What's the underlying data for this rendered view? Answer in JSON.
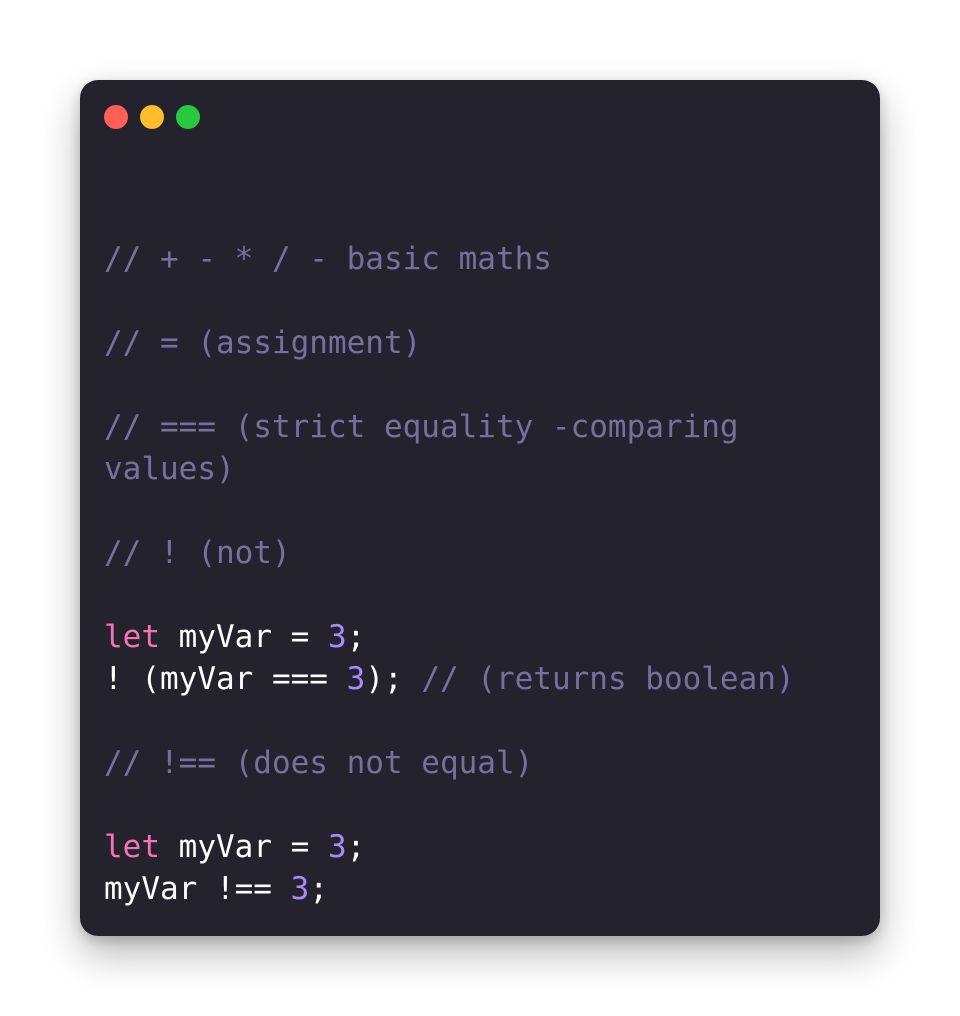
{
  "window": {
    "controls": [
      {
        "name": "close",
        "color": "#ff5f57"
      },
      {
        "name": "minimize",
        "color": "#febc2e"
      },
      {
        "name": "zoom",
        "color": "#28c840"
      }
    ]
  },
  "colors": {
    "background": "#24222c",
    "comment": "#77709f",
    "keyword": "#f472b6",
    "number": "#a78bfa",
    "text": "#ffffff"
  },
  "code": {
    "lines": [
      [
        {
          "type": "comment",
          "text": "// + - * / - basic maths"
        }
      ],
      [],
      [
        {
          "type": "comment",
          "text": "// = (assignment)"
        }
      ],
      [],
      [
        {
          "type": "comment",
          "text": "// === (strict equality -comparing"
        }
      ],
      [
        {
          "type": "comment",
          "text": "values)"
        }
      ],
      [],
      [
        {
          "type": "comment",
          "text": "// ! (not)"
        }
      ],
      [],
      [
        {
          "type": "keyword",
          "text": "let"
        },
        {
          "type": "plain",
          "text": " myVar = "
        },
        {
          "type": "number",
          "text": "3"
        },
        {
          "type": "plain",
          "text": ";"
        }
      ],
      [
        {
          "type": "plain",
          "text": "! (myVar === "
        },
        {
          "type": "number",
          "text": "3"
        },
        {
          "type": "plain",
          "text": "); "
        },
        {
          "type": "comment",
          "text": "// (returns boolean)"
        }
      ],
      [],
      [
        {
          "type": "comment",
          "text": "// !== (does not equal)"
        }
      ],
      [],
      [
        {
          "type": "keyword",
          "text": "let"
        },
        {
          "type": "plain",
          "text": " myVar = "
        },
        {
          "type": "number",
          "text": "3"
        },
        {
          "type": "plain",
          "text": ";"
        }
      ],
      [
        {
          "type": "plain",
          "text": "myVar !== "
        },
        {
          "type": "number",
          "text": "3"
        },
        {
          "type": "plain",
          "text": ";"
        }
      ]
    ]
  }
}
